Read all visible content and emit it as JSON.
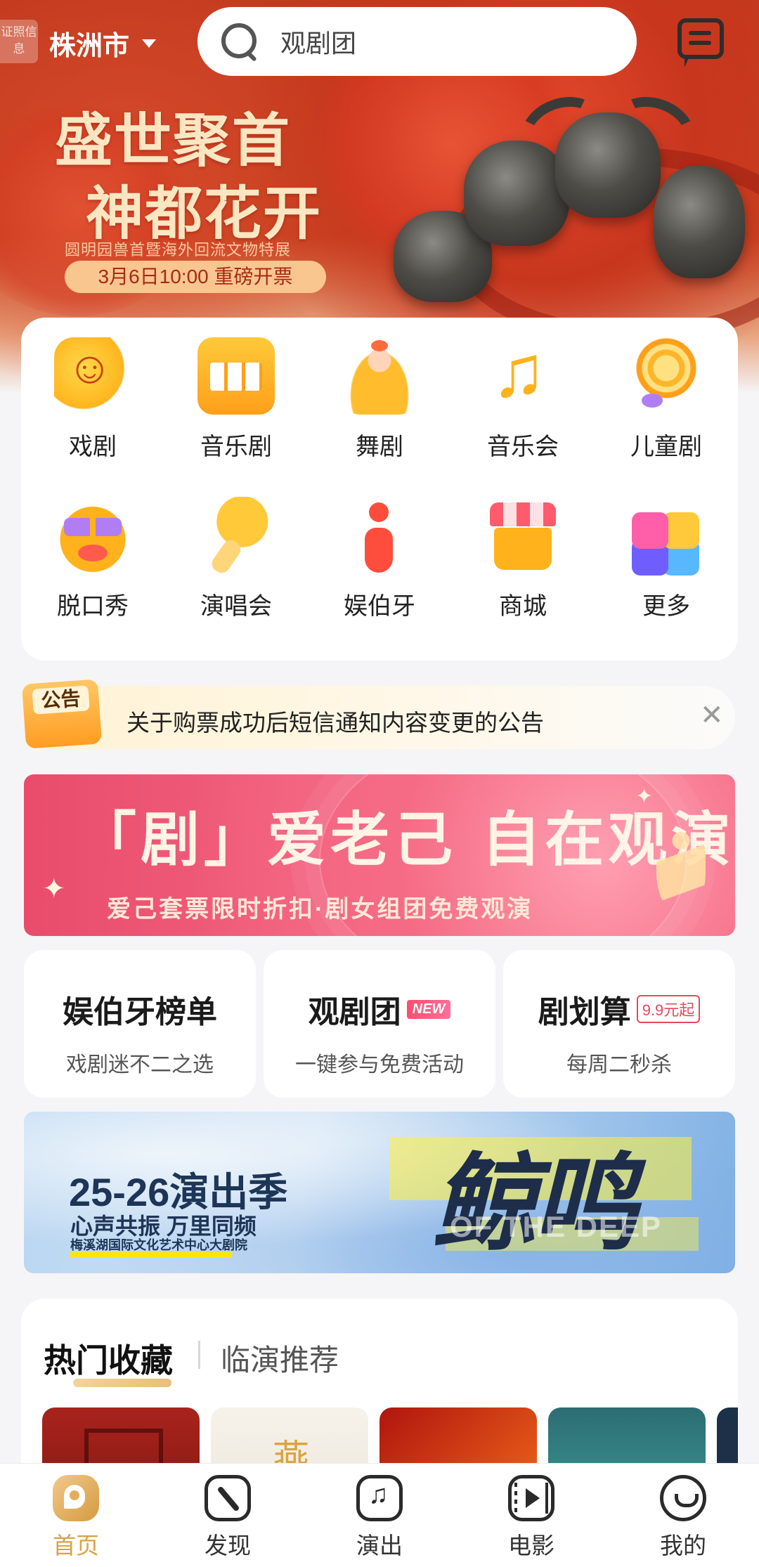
{
  "header": {
    "tag_chip": "证照信息",
    "city": "株洲市",
    "search_placeholder": "观剧团"
  },
  "hero": {
    "title_line1": "盛世聚首",
    "title_line2": "神都花开",
    "subtitle": "圆明园兽首暨海外回流文物特展",
    "pill": "3月6日10:00 重磅开票"
  },
  "categories": [
    {
      "label": "戏剧",
      "icon": "drama-mask-icon"
    },
    {
      "label": "音乐剧",
      "icon": "piano-icon"
    },
    {
      "label": "舞剧",
      "icon": "dancer-icon"
    },
    {
      "label": "音乐会",
      "icon": "music-note-icon"
    },
    {
      "label": "儿童剧",
      "icon": "lollipop-icon"
    },
    {
      "label": "脱口秀",
      "icon": "sunglasses-face-icon"
    },
    {
      "label": "演唱会",
      "icon": "microphone-icon"
    },
    {
      "label": "娱伯牙",
      "icon": "brand-figure-icon"
    },
    {
      "label": "商城",
      "icon": "shop-icon"
    },
    {
      "label": "更多",
      "icon": "puzzle-icon"
    }
  ],
  "notice": {
    "tag": "公告",
    "text": "关于购票成功后短信通知内容变更的公告",
    "close": "✕"
  },
  "promo": {
    "title": "「剧」爱老己  自在观演",
    "subtitle": "爱己套票限时折扣·剧女组团免费观演"
  },
  "features": [
    {
      "title": "娱伯牙榜单",
      "badge": "",
      "subtitle": "戏剧迷不二之选"
    },
    {
      "title": "观剧团",
      "badge": "NEW",
      "subtitle": "一键参与免费活动"
    },
    {
      "title": "剧划算",
      "badge": "9.9元起",
      "subtitle": "每周二秒杀"
    }
  ],
  "season": {
    "title": "25-26演出季",
    "line1": "心声共振 万里同频",
    "line2": "梅溪湖国际文化艺术中心大剧院",
    "big": "鲸鸣",
    "en": "OF THE DEEP"
  },
  "hot": {
    "tab_active": "热门收藏",
    "tab_other": "临演推荐"
  },
  "tabbar": [
    {
      "label": "首页",
      "icon": "home-icon",
      "active": true
    },
    {
      "label": "发现",
      "icon": "compass-icon",
      "active": false
    },
    {
      "label": "演出",
      "icon": "music-icon",
      "active": false
    },
    {
      "label": "电影",
      "icon": "film-icon",
      "active": false
    },
    {
      "label": "我的",
      "icon": "smile-icon",
      "active": false
    }
  ],
  "colors": {
    "accent": "#d9a24a",
    "hero_red": "#c23a1f",
    "promo_pink": "#e94c6b"
  }
}
